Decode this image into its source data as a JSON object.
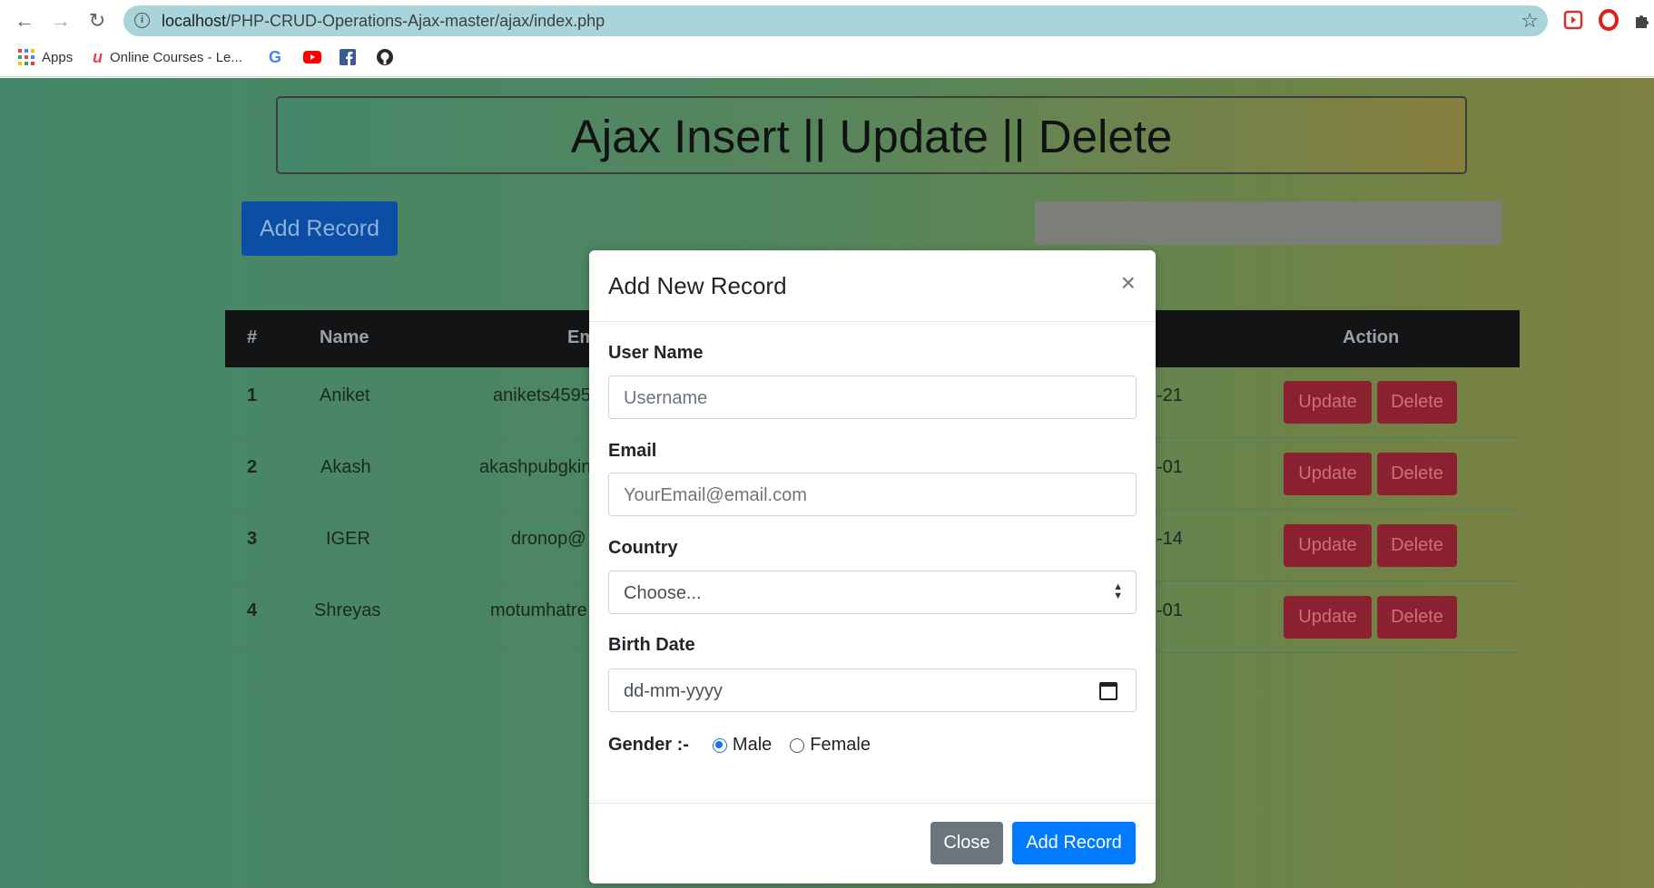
{
  "browser": {
    "url_host": "localhost",
    "url_path": "/PHP-CRUD-Operations-Ajax-master/ajax/index.php",
    "bookmarks": [
      {
        "label": "Apps",
        "icon": "apps-grid-icon"
      },
      {
        "label": "Online Courses - Le...",
        "icon": "udemy-icon"
      },
      {
        "label": "",
        "icon": "google-icon"
      },
      {
        "label": "",
        "icon": "youtube-icon"
      },
      {
        "label": "",
        "icon": "facebook-icon"
      },
      {
        "label": "",
        "icon": "github-icon"
      }
    ]
  },
  "page": {
    "title": "Ajax Insert || Update || Delete",
    "add_record_button": "Add Record",
    "table": {
      "headers": [
        "#",
        "Name",
        "Em",
        "Action"
      ],
      "rows": [
        {
          "num": "1",
          "name": "Aniket",
          "email": "anikets4595",
          "date": "-21"
        },
        {
          "num": "2",
          "name": "Akash",
          "email": "akashpubgkin",
          "date": "-01"
        },
        {
          "num": "3",
          "name": "IGER",
          "email": "dronop@",
          "date": "-14"
        },
        {
          "num": "4",
          "name": "Shreyas",
          "email": "motumhatre",
          "date": "-01"
        }
      ],
      "update_label": "Update",
      "delete_label": "Delete"
    }
  },
  "modal": {
    "title": "Add New Record",
    "close_symbol": "×",
    "username_label": "User Name",
    "username_placeholder": "Username",
    "email_label": "Email",
    "email_placeholder": "YourEmail@email.com",
    "country_label": "Country",
    "country_selected": "Choose...",
    "birth_label": "Birth Date",
    "birth_placeholder": "dd-mm-yyyy",
    "gender_label": "Gender :-",
    "gender_options": [
      "Male",
      "Female"
    ],
    "gender_selected": "Male",
    "close_button": "Close",
    "add_button": "Add Record"
  },
  "colors": {
    "primary": "#007bff",
    "secondary": "#6c757d",
    "danger": "#8a2030",
    "table_header": "#121416"
  }
}
